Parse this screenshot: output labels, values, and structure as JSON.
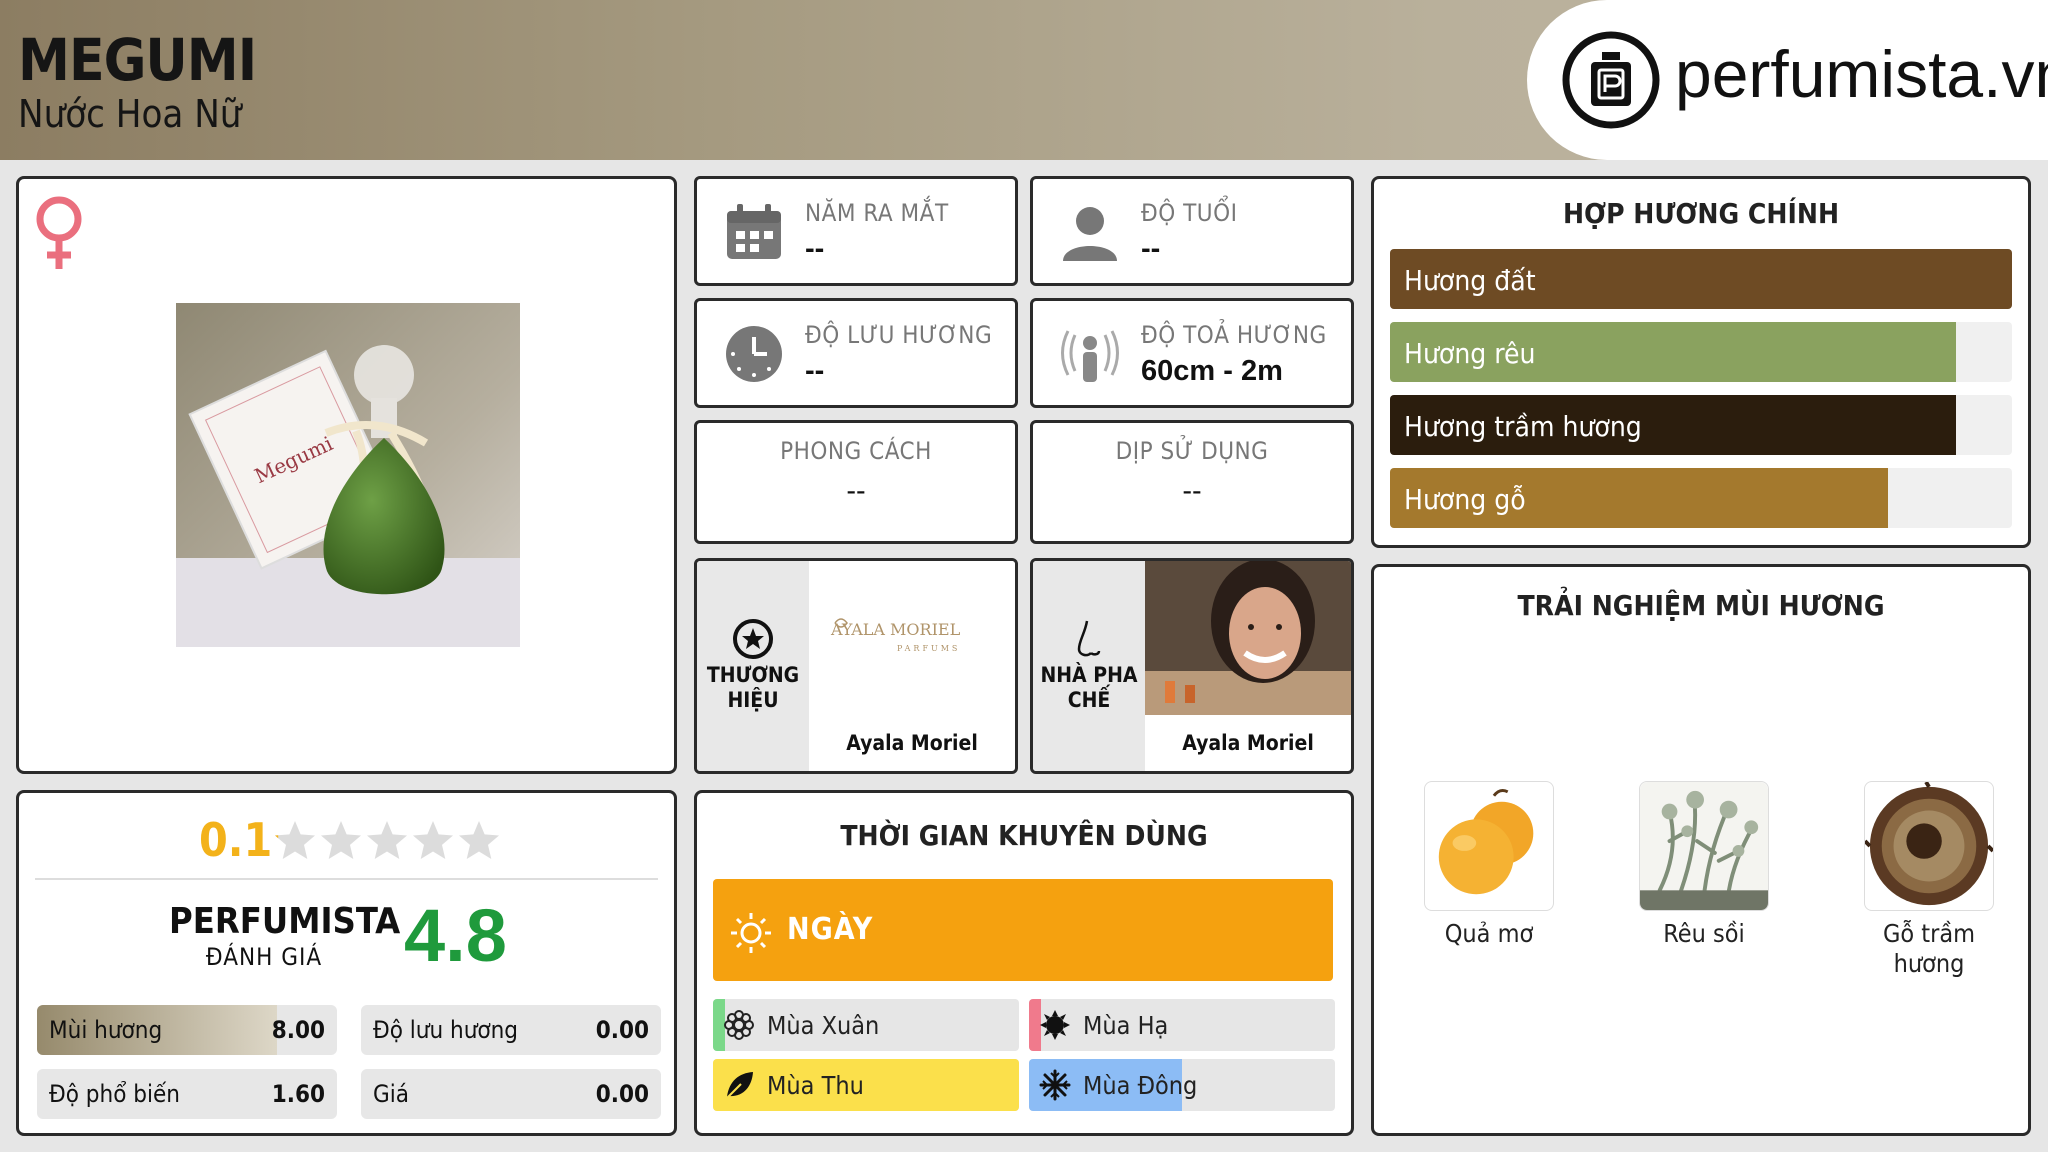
{
  "header": {
    "title": "MEGUMI",
    "subtitle": "Nước Hoa Nữ",
    "logo_text": "perfumista.vn"
  },
  "image_panel": {
    "gender_icon": "female-icon",
    "photo_label": "Megumi"
  },
  "info": {
    "launch_year": {
      "label": "NĂM RA MẮT",
      "value": "--",
      "icon": "calendar-icon"
    },
    "age": {
      "label": "ĐỘ TUỔI",
      "value": "--",
      "icon": "person-icon"
    },
    "longevity": {
      "label": "ĐỘ LƯU HƯƠNG",
      "value": "--",
      "icon": "clock-icon"
    },
    "sillage": {
      "label": "ĐỘ TOẢ HƯƠNG",
      "value": "60cm - 2m",
      "icon": "radiate-icon"
    },
    "style": {
      "label": "PHONG CÁCH",
      "value": "--"
    },
    "occasion": {
      "label": "DỊP SỬ DỤNG",
      "value": "--"
    }
  },
  "brand": {
    "label": "THƯƠNG HIỆU",
    "name": "Ayala Moriel",
    "logo_text": "AYALA MORIEL",
    "logo_sub": "PARFUMS"
  },
  "perfumer": {
    "label": "NHÀ PHA CHẾ",
    "name": "Ayala Moriel"
  },
  "rating": {
    "user_score": "0.1",
    "stars_filled_fraction": 0.02,
    "perfumista_label": "PERFUMISTA",
    "perfumista_sub": "ĐÁNH GIÁ",
    "perfumista_score": "4.8",
    "metrics": [
      {
        "label": "Mùi hương",
        "value": "8.00",
        "fraction": 0.8
      },
      {
        "label": "Độ lưu hương",
        "value": "0.00",
        "fraction": 0
      },
      {
        "label": "Độ phổ biến",
        "value": "1.60",
        "fraction": 0
      },
      {
        "label": "Giá",
        "value": "0.00",
        "fraction": 0
      }
    ]
  },
  "time": {
    "title": "THỜI GIAN KHUYÊN DÙNG",
    "day_label": "NGÀY",
    "day_fraction": 1.0,
    "seasons": [
      {
        "label": "Mùa Xuân",
        "fraction": 0.04,
        "color": "#7bd889"
      },
      {
        "label": "Mùa Hạ",
        "fraction": 0.04,
        "color": "#f07a8c"
      },
      {
        "label": "Mùa Thu",
        "fraction": 1.0,
        "color": "#fbe04b"
      },
      {
        "label": "Mùa Đông",
        "fraction": 0.5,
        "color": "#8cbcf5"
      }
    ]
  },
  "accords": {
    "title": "HỢP HƯƠNG CHÍNH",
    "items": [
      {
        "label": "Hương đất",
        "fraction": 1.0,
        "color": "#6e4b24"
      },
      {
        "label": "Hương rêu",
        "fraction": 0.91,
        "color": "#8aa25f"
      },
      {
        "label": "Hương trầm hương",
        "fraction": 0.91,
        "color": "#2b1d0d"
      },
      {
        "label": "Hương gỗ",
        "fraction": 0.8,
        "color": "#a4792d"
      }
    ]
  },
  "notes": {
    "title": "TRẢI NGHIỆM MÙI HƯƠNG",
    "items": [
      {
        "label": "Quả mơ"
      },
      {
        "label": "Rêu sồi"
      },
      {
        "label": "Gỗ trầm hương"
      }
    ]
  }
}
